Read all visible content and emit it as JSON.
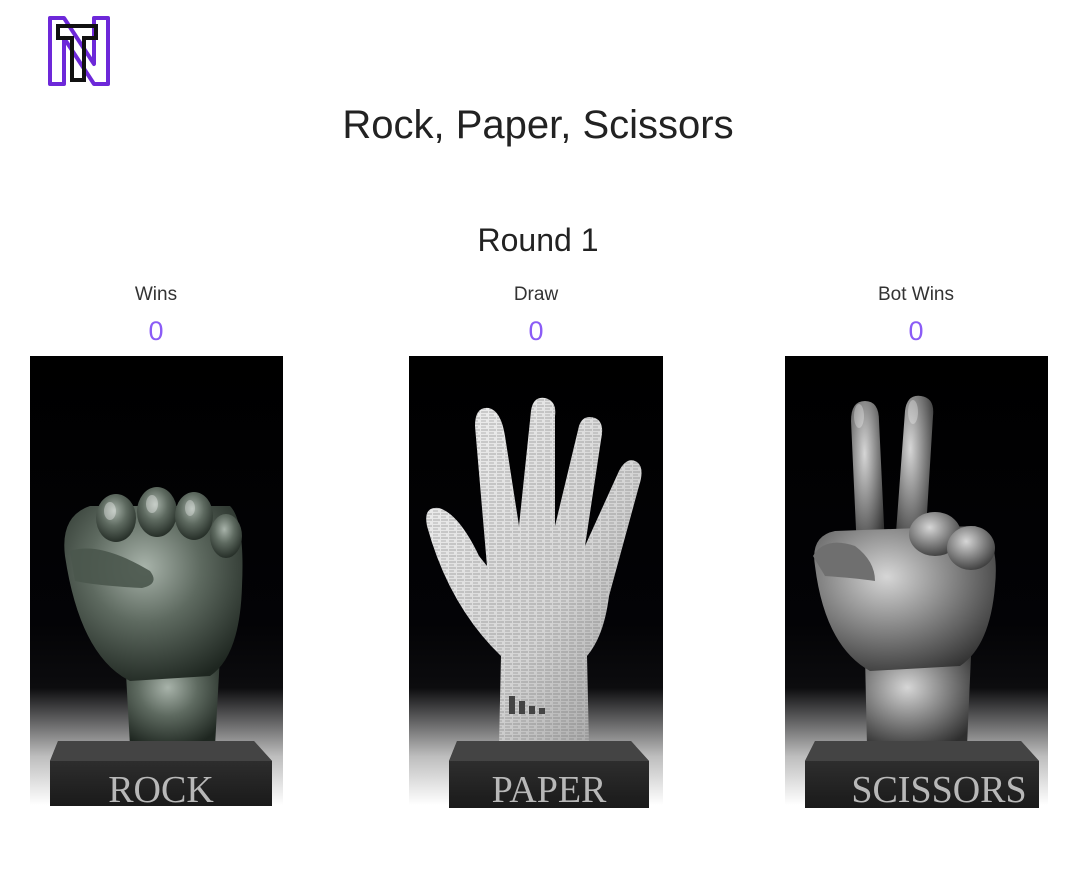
{
  "header": {
    "logo_icon": "nt-monogram-logo",
    "logo_colors": {
      "outer": "#6d28d9",
      "inner": "#111111"
    }
  },
  "title": "Rock, Paper, Scissors",
  "round_label": "Round 1",
  "scores": [
    {
      "label": "Wins",
      "value": "0"
    },
    {
      "label": "Draw",
      "value": "0"
    },
    {
      "label": "Bot Wins",
      "value": "0"
    }
  ],
  "choices": [
    {
      "label": "ROCK",
      "icon": "rock-fist-icon"
    },
    {
      "label": "PAPER",
      "icon": "paper-open-hand-icon"
    },
    {
      "label": "SCISSORS",
      "icon": "scissors-peace-hand-icon"
    }
  ],
  "colors": {
    "score_accent": "#8b5cf6",
    "rock": "#5e6a60",
    "paper": "#d9d9d9",
    "scissors": "#8a8a8a"
  }
}
